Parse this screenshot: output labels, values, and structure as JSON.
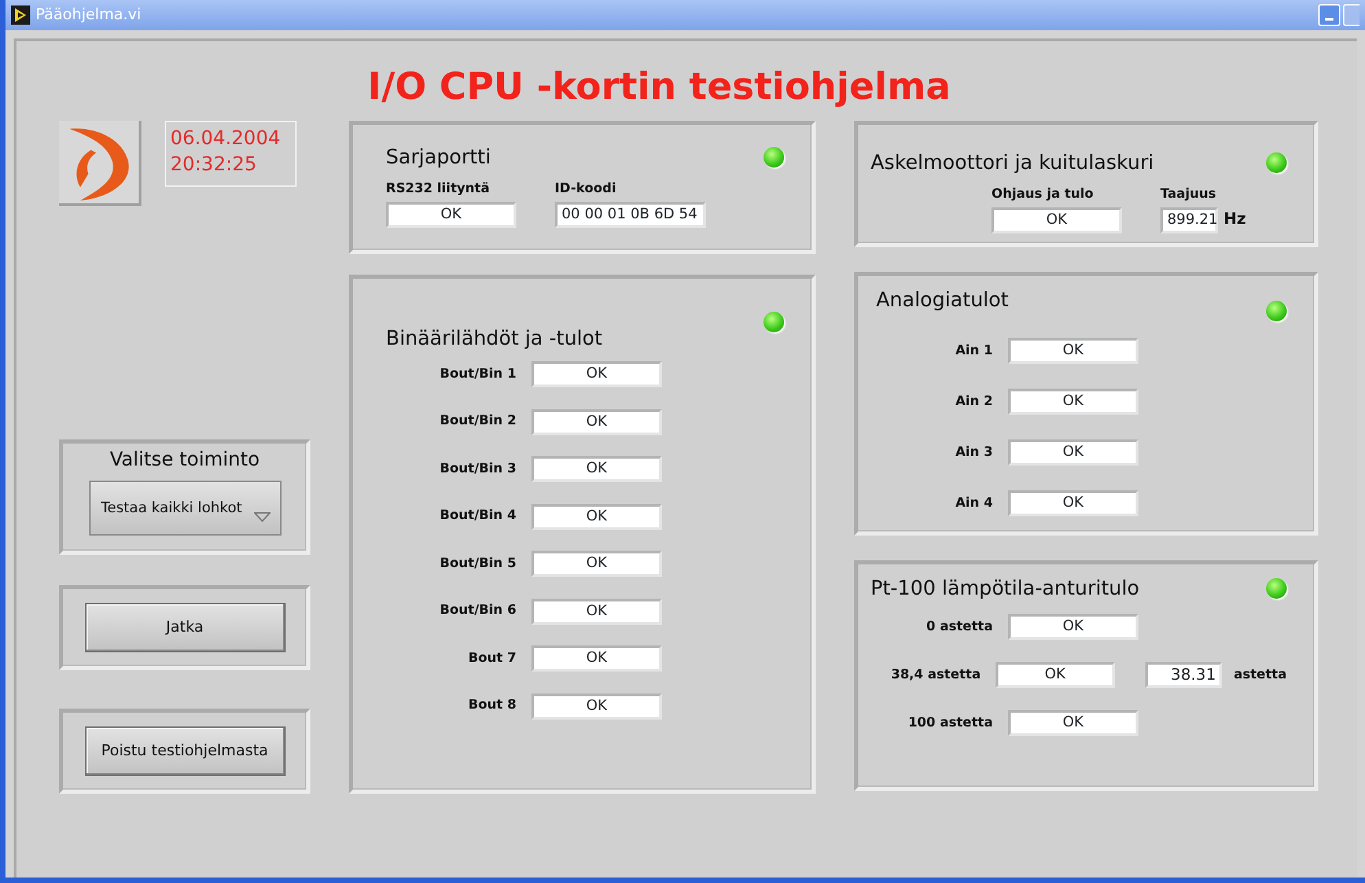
{
  "window": {
    "title": "Pääohjelma.vi"
  },
  "heading": "I/O CPU -kortin testiohjelma",
  "clock": {
    "date": "06.04.2004",
    "time": "20:32:25"
  },
  "function_select": {
    "label": "Valitse toiminto",
    "value": "Testaa kaikki lohkot"
  },
  "buttons": [
    "Jatka",
    "Poistu testiohjelmasta"
  ],
  "panels": [
    {
      "title": "Sarjaportti",
      "led_on": true,
      "kind": "columns",
      "fields": [
        {
          "label": "RS232 liityntä",
          "value": "OK",
          "kind": "status"
        },
        {
          "label": "ID-koodi",
          "value": "00 00 01 0B 6D 54",
          "kind": "text"
        }
      ]
    },
    {
      "title": "Binäärilähdöt ja -tulot",
      "led_on": true,
      "kind": "rows",
      "fields": [
        {
          "label": "Bout/Bin 1",
          "value": "OK",
          "kind": "status"
        },
        {
          "label": "Bout/Bin 2",
          "value": "OK",
          "kind": "status"
        },
        {
          "label": "Bout/Bin 3",
          "value": "OK",
          "kind": "status"
        },
        {
          "label": "Bout/Bin 4",
          "value": "OK",
          "kind": "status"
        },
        {
          "label": "Bout/Bin 5",
          "value": "OK",
          "kind": "status"
        },
        {
          "label": "Bout/Bin 6",
          "value": "OK",
          "kind": "status"
        },
        {
          "label": "Bout 7",
          "value": "OK",
          "kind": "status"
        },
        {
          "label": "Bout 8",
          "value": "OK",
          "kind": "status"
        }
      ]
    },
    {
      "title": "Askelmoottori ja kuitulaskuri",
      "led_on": true,
      "kind": "columns",
      "fields": [
        {
          "label": "Ohjaus ja tulo",
          "value": "OK",
          "kind": "status"
        },
        {
          "label": "Taajuus",
          "value": "899.21",
          "kind": "number",
          "unit": "Hz"
        }
      ]
    },
    {
      "title": "Analogiatulot",
      "led_on": true,
      "kind": "rows",
      "fields": [
        {
          "label": "Ain 1",
          "value": "OK",
          "kind": "status"
        },
        {
          "label": "Ain 2",
          "value": "OK",
          "kind": "status"
        },
        {
          "label": "Ain 3",
          "value": "OK",
          "kind": "status"
        },
        {
          "label": "Ain 4",
          "value": "OK",
          "kind": "status"
        }
      ]
    },
    {
      "title": "Pt-100 lämpötila-anturitulo",
      "led_on": true,
      "kind": "rows",
      "fields": [
        {
          "label": "0 astetta",
          "value": "OK",
          "kind": "status"
        },
        {
          "label": "38,4 astetta",
          "value": "OK",
          "kind": "status",
          "reading": "38.31",
          "unit": "astetta"
        },
        {
          "label": "100 astetta",
          "value": "OK",
          "kind": "status"
        }
      ]
    }
  ]
}
